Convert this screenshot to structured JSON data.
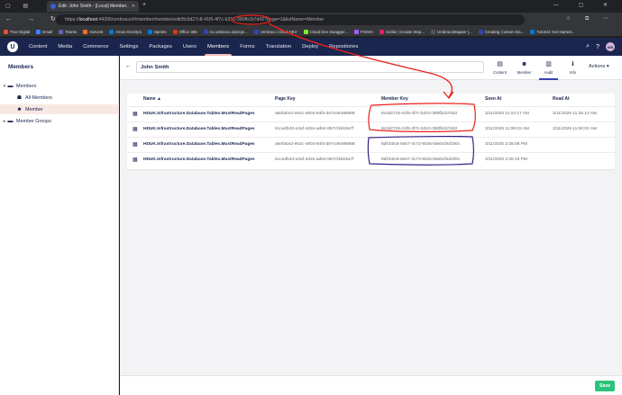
{
  "browser": {
    "tab_title": "Edit: John Smith - [Local] Member...",
    "url_prefix": "https://",
    "url_host": "localhost",
    "url_rest": ":44395/umbraco/#/member/member/edit/8c0d27c8-41f6-4f7c-b310-390fb1b7d42?page=1&listName=Member",
    "bookmarks": [
      {
        "label": "True Digital",
        "color": "#e84c3d"
      },
      {
        "label": "Email",
        "color": "#3b82f6"
      },
      {
        "label": "Teams",
        "color": "#6264a7"
      },
      {
        "label": "Harvest",
        "color": "#f36c21"
      },
      {
        "label": "Azure DevOps",
        "color": "#0078d4"
      },
      {
        "label": "Sprints",
        "color": "#0078d4"
      },
      {
        "label": "Office 365",
        "color": "#d83b01"
      },
      {
        "label": "s1.umbraco.io/proje...",
        "color": "#3544b1"
      },
      {
        "label": "Umbraco Cloud DEV",
        "color": "#3544b1"
      },
      {
        "label": "Cloud Dev Swagger...",
        "color": "#85ea2d"
      },
      {
        "label": "FIGMA",
        "color": "#a259ff"
      },
      {
        "label": "Scribe | Create Step...",
        "color": "#e91e63"
      },
      {
        "label": "UmbracoMapper |...",
        "color": "#555"
      },
      {
        "label": "Creating Custom Da...",
        "color": "#3544b1"
      },
      {
        "label": "Tutorial: Get started...",
        "color": "#0078d4"
      }
    ]
  },
  "header": {
    "sections": [
      "Content",
      "Media",
      "Commerce",
      "Settings",
      "Packages",
      "Users",
      "Members",
      "Forms",
      "Translation",
      "Deploy",
      "Repositories"
    ],
    "active_section": "Members",
    "avatar_initials": "WB"
  },
  "tree": {
    "title": "Members",
    "items": [
      {
        "label": "Members",
        "level": 0,
        "icon": "folder"
      },
      {
        "label": "All Members",
        "level": 1,
        "icon": "users"
      },
      {
        "label": "Member",
        "level": 1,
        "icon": "user"
      },
      {
        "label": "Member Groups",
        "level": 0,
        "icon": "folder"
      }
    ]
  },
  "editor": {
    "name": "John Smith",
    "apps": [
      {
        "label": "Content",
        "icon": "content-icon"
      },
      {
        "label": "Member",
        "icon": "member-icon"
      },
      {
        "label": "Audit",
        "icon": "audit-icon"
      },
      {
        "label": "Info",
        "icon": "info-icon"
      }
    ],
    "active_app": "Audit",
    "actions_label": "Actions",
    "save_label": "Save"
  },
  "table": {
    "columns": [
      "Name",
      "Page Key",
      "Member Key",
      "Seen At",
      "Read At"
    ],
    "sort_indicator": "▲",
    "rows": [
      {
        "name": "HDUK.Infrastructure.Database.Tables.MustReadPages",
        "page_key": "a6efab42-e62c-4904-84f4-de7ce6486968",
        "member_key": "8c0d27c8-41f6-4f7c-b310-390fb1b7d42",
        "seen_at": "3/11/2025 11:02:17 AM",
        "read_at": "3/11/2025 11:25:12 AM"
      },
      {
        "name": "HDUK.Infrastructure.Database.Tables.MustReadPages",
        "page_key": "61cedb43-e2af-4d2e-ad64-857cf1b63a7f",
        "member_key": "8c0d27c8-41f6-4f7c-b310-390fb1b7d42",
        "seen_at": "3/11/2025 11:06:02 AM",
        "read_at": "3/11/2025 11:06:02 AM"
      },
      {
        "name": "HDUK.Infrastructure.Database.Tables.MustReadPages",
        "page_key": "a6efab42-e62c-4904-84f4-de7ce6486968",
        "member_key": "8dfcb0c6-6e57-4c72-8cb5-b8ebcfed200c",
        "seen_at": "3/11/2025 2:28:08 PM",
        "read_at": ""
      },
      {
        "name": "HDUK.Infrastructure.Database.Tables.MustReadPages",
        "page_key": "61cedb43-e2af-4d2e-ad64-857cf1b63a7f",
        "member_key": "8dfcb0c6-6e57-4c72-8cb5-b8ebcfed200c",
        "seen_at": "3/11/2025 2:28:19 PM",
        "read_at": ""
      }
    ]
  },
  "colors": {
    "header_bg": "#1b264f",
    "highlight_red": "#e8201c",
    "highlight_purple": "#3a1e8c",
    "save_green": "#2bc37c"
  }
}
